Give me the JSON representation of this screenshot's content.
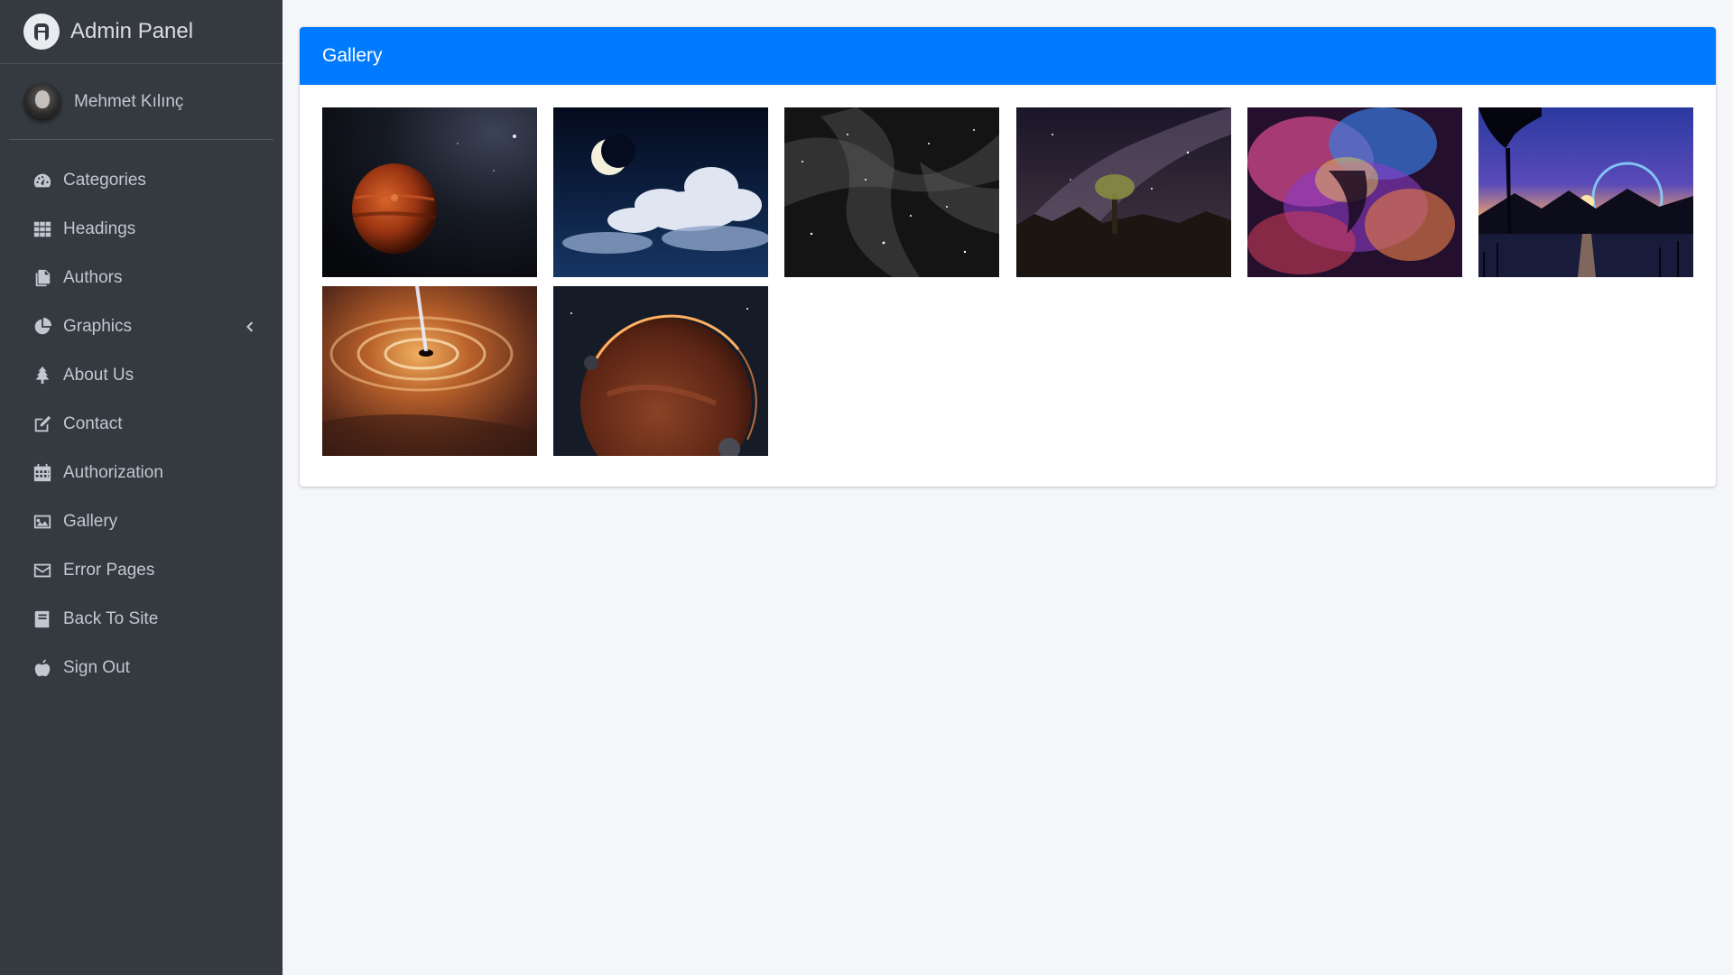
{
  "brand": {
    "title": "Admin Panel"
  },
  "user": {
    "name": "Mehmet Kılınç"
  },
  "sidebar": {
    "items": [
      {
        "label": "Categories",
        "icon": "tachometer-icon"
      },
      {
        "label": "Headings",
        "icon": "grid-icon"
      },
      {
        "label": "Authors",
        "icon": "copy-icon"
      },
      {
        "label": "Graphics",
        "icon": "pie-chart-icon",
        "has_submenu": true
      },
      {
        "label": "About Us",
        "icon": "tree-icon"
      },
      {
        "label": "Contact",
        "icon": "edit-icon"
      },
      {
        "label": "Authorization",
        "icon": "calendar-icon"
      },
      {
        "label": "Gallery",
        "icon": "image-icon"
      },
      {
        "label": "Error Pages",
        "icon": "envelope-icon"
      },
      {
        "label": "Back To Site",
        "icon": "book-icon"
      },
      {
        "label": "Sign Out",
        "icon": "apple-icon"
      }
    ]
  },
  "main": {
    "card_title": "Gallery",
    "header_color": "#007bff",
    "images": [
      {
        "subject": "red-planet-in-space"
      },
      {
        "subject": "crescent-moon-and-clouds"
      },
      {
        "subject": "grayscale-nebula"
      },
      {
        "subject": "milky-way-desert-tree"
      },
      {
        "subject": "colorful-nebula"
      },
      {
        "subject": "moonrise-over-mountains-lake"
      },
      {
        "subject": "black-hole-accretion-disk"
      },
      {
        "subject": "orange-planet-with-moons"
      }
    ]
  },
  "colors": {
    "sidebar_bg": "#343a40",
    "sidebar_text": "#c2c7d0",
    "page_bg": "#f4f6f9",
    "accent": "#007bff"
  }
}
